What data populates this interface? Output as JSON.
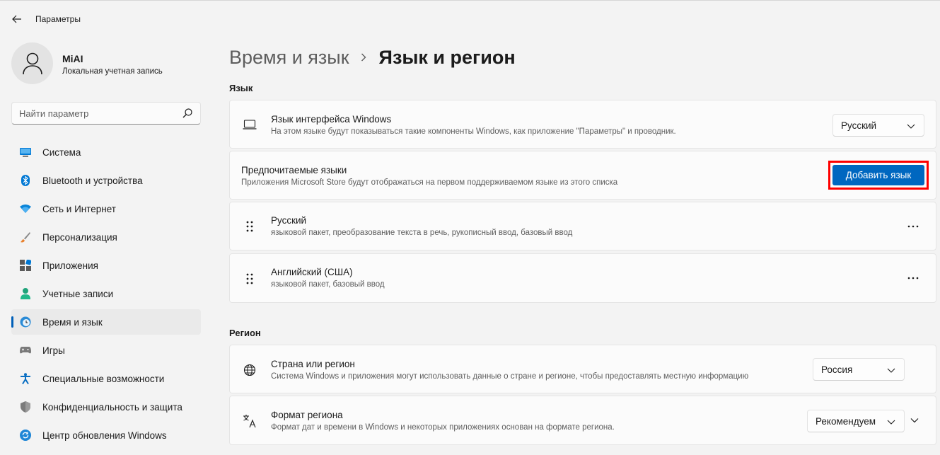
{
  "app": {
    "title": "Параметры"
  },
  "profile": {
    "name": "MiAI",
    "account_type": "Локальная учетная запись"
  },
  "search": {
    "placeholder": "Найти параметр"
  },
  "sidebar": {
    "items": [
      {
        "label": "Система",
        "icon": "monitor-icon"
      },
      {
        "label": "Bluetooth и устройства",
        "icon": "bluetooth-icon"
      },
      {
        "label": "Сеть и Интернет",
        "icon": "wifi-icon"
      },
      {
        "label": "Персонализация",
        "icon": "brush-icon"
      },
      {
        "label": "Приложения",
        "icon": "apps-icon"
      },
      {
        "label": "Учетные записи",
        "icon": "person-icon"
      },
      {
        "label": "Время и язык",
        "icon": "clock-globe-icon",
        "active": true
      },
      {
        "label": "Игры",
        "icon": "gamepad-icon"
      },
      {
        "label": "Специальные возможности",
        "icon": "accessibility-icon"
      },
      {
        "label": "Конфиденциальность и защита",
        "icon": "shield-icon"
      },
      {
        "label": "Центр обновления Windows",
        "icon": "update-icon"
      }
    ]
  },
  "breadcrumb": {
    "parent": "Время и язык",
    "current": "Язык и регион"
  },
  "language_section": {
    "title": "Язык",
    "display_language": {
      "title": "Язык интерфейса Windows",
      "description": "На этом языке будут показываться такие компоненты Windows, как приложение \"Параметры\" и проводник.",
      "value": "Русский"
    },
    "preferred": {
      "title": "Предпочитаемые языки",
      "description": "Приложения Microsoft Store будут отображаться на первом поддерживаемом языке из этого списка",
      "add_button": "Добавить язык"
    },
    "languages": [
      {
        "name": "Русский",
        "features": "языковой пакет, преобразование текста в речь, рукописный ввод, базовый ввод"
      },
      {
        "name": "Английский (США)",
        "features": "языковой пакет, базовый ввод"
      }
    ]
  },
  "region_section": {
    "title": "Регион",
    "country": {
      "title": "Страна или регион",
      "description": "Система Windows и приложения могут использовать данные о стране и регионе, чтобы предоставлять местную информацию",
      "value": "Россия"
    },
    "format": {
      "title": "Формат региона",
      "description": "Формат дат и времени в Windows и некоторых приложениях основан на формате региона.",
      "value": "Рекомендуем"
    }
  },
  "colors": {
    "accent": "#0067c0",
    "highlight_box": "#ff0000"
  }
}
